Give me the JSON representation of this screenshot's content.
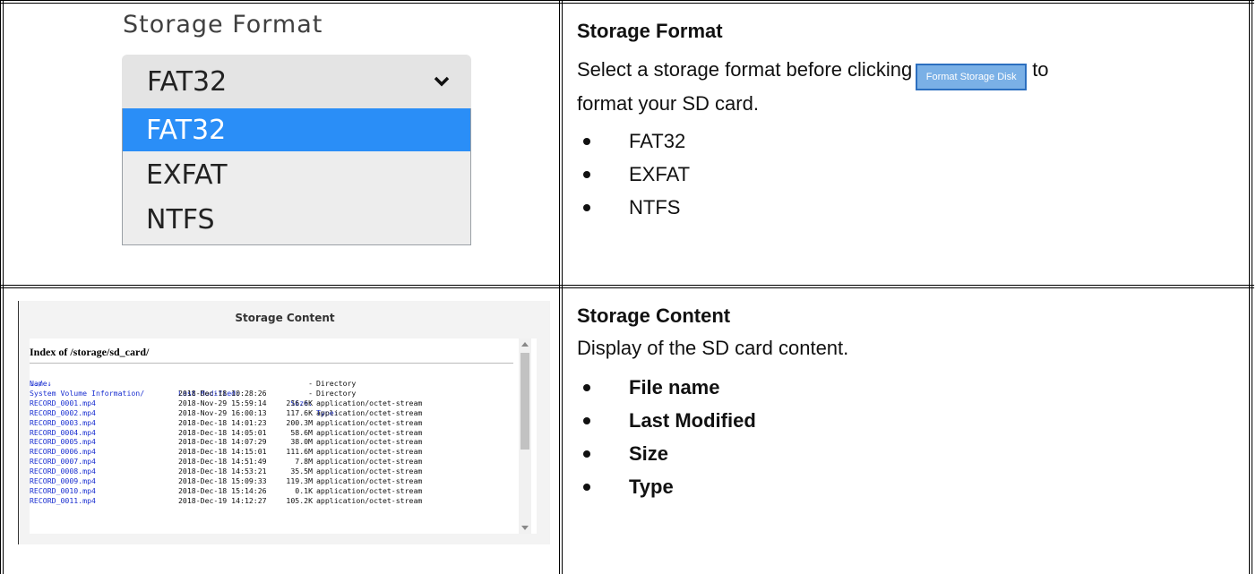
{
  "format_panel": {
    "screenshot": {
      "title": "Storage Format",
      "selected_value": "FAT32",
      "options": [
        "FAT32",
        "EXFAT",
        "NTFS"
      ]
    },
    "heading": "Storage Format",
    "description_before": "Select a storage format before clicking",
    "button_label": "Format Storage Disk",
    "description_after": "to",
    "description_line2": "format your SD card.",
    "bullets": [
      "FAT32",
      "EXFAT",
      "NTFS"
    ],
    "selected_option_color": "#2a8ef7"
  },
  "content_panel": {
    "screenshot": {
      "title": "Storage Content",
      "index_title": "Index of /storage/sd_card/",
      "headers": {
        "name": "Name↓",
        "modified": "Last Modified:",
        "size": "Size:",
        "type": "Type:"
      },
      "rows": [
        {
          "name": "../",
          "modified": "",
          "size": "-",
          "type": "Directory"
        },
        {
          "name": "System Volume Information/",
          "modified": "2018-Dec-18 10:28:26",
          "size": "-",
          "type": "Directory"
        },
        {
          "name": "RECORD_0001.mp4",
          "modified": "2018-Nov-29 15:59:14",
          "size": "216.6K",
          "type": "application/octet-stream"
        },
        {
          "name": "RECORD_0002.mp4",
          "modified": "2018-Nov-29 16:00:13",
          "size": "117.6K",
          "type": "application/octet-stream"
        },
        {
          "name": "RECORD_0003.mp4",
          "modified": "2018-Dec-18 14:01:23",
          "size": "200.3M",
          "type": "application/octet-stream"
        },
        {
          "name": "RECORD_0004.mp4",
          "modified": "2018-Dec-18 14:05:01",
          "size": "58.6M",
          "type": "application/octet-stream"
        },
        {
          "name": "RECORD_0005.mp4",
          "modified": "2018-Dec-18 14:07:29",
          "size": "38.0M",
          "type": "application/octet-stream"
        },
        {
          "name": "RECORD_0006.mp4",
          "modified": "2018-Dec-18 14:15:01",
          "size": "111.6M",
          "type": "application/octet-stream"
        },
        {
          "name": "RECORD_0007.mp4",
          "modified": "2018-Dec-18 14:51:49",
          "size": "7.8M",
          "type": "application/octet-stream"
        },
        {
          "name": "RECORD_0008.mp4",
          "modified": "2018-Dec-18 14:53:21",
          "size": "35.5M",
          "type": "application/octet-stream"
        },
        {
          "name": "RECORD_0009.mp4",
          "modified": "2018-Dec-18 15:09:33",
          "size": "119.3M",
          "type": "application/octet-stream"
        },
        {
          "name": "RECORD_0010.mp4",
          "modified": "2018-Dec-18 15:14:26",
          "size": "0.1K",
          "type": "application/octet-stream"
        },
        {
          "name": "RECORD_0011.mp4",
          "modified": "2018-Dec-19 14:12:27",
          "size": "105.2K",
          "type": "application/octet-stream"
        }
      ]
    },
    "heading": "Storage Content",
    "description": "Display of the SD card content.",
    "bullets": [
      "File name",
      "Last Modified",
      "Size",
      "Type"
    ]
  },
  "icons": {
    "dropdown": "chevron-down-icon",
    "scroll_up": "scroll-up-arrow-icon",
    "scroll_down": "scroll-down-arrow-icon"
  }
}
